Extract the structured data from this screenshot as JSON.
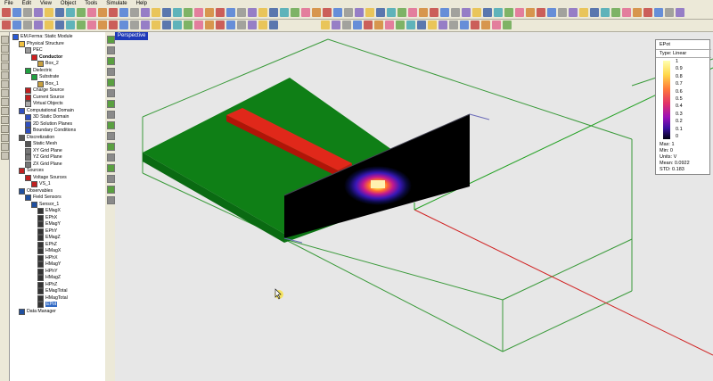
{
  "menu": [
    "File",
    "Edit",
    "View",
    "Object",
    "Tools",
    "Simulate",
    "Help"
  ],
  "viewport": {
    "tab_label": "Perspective"
  },
  "tree": [
    {
      "label": "EM.Ferma: Static Module",
      "depth": 0,
      "icon": "app-icon"
    },
    {
      "label": "Physical Structure",
      "depth": 1,
      "icon": "folder-icon"
    },
    {
      "label": "PEC",
      "depth": 2,
      "icon": "pec-icon"
    },
    {
      "label": "Conductor",
      "depth": 3,
      "icon": "conductor-icon",
      "bold": true
    },
    {
      "label": "Box_2",
      "depth": 4,
      "icon": "box-icon"
    },
    {
      "label": "Dielectric",
      "depth": 2,
      "icon": "dielectric-icon"
    },
    {
      "label": "Substrate",
      "depth": 3,
      "icon": "substrate-icon"
    },
    {
      "label": "Box_1",
      "depth": 4,
      "icon": "box-icon"
    },
    {
      "label": "Charge Source",
      "depth": 2,
      "icon": "charge-icon"
    },
    {
      "label": "Current Source",
      "depth": 2,
      "icon": "current-icon"
    },
    {
      "label": "Virtual Objects",
      "depth": 2,
      "icon": "virtual-icon"
    },
    {
      "label": "Computational Domain",
      "depth": 1,
      "icon": "domain-icon"
    },
    {
      "label": "3D Static Domain",
      "depth": 2,
      "icon": "domain3d-icon"
    },
    {
      "label": "2D Solution Planes",
      "depth": 2,
      "icon": "plane-icon"
    },
    {
      "label": "Boundary Conditions",
      "depth": 2,
      "icon": "boundary-icon"
    },
    {
      "label": "Discretization",
      "depth": 1,
      "icon": "mesh-folder-icon"
    },
    {
      "label": "Static Mesh",
      "depth": 2,
      "icon": "mesh-icon"
    },
    {
      "label": "XY Grid Plane",
      "depth": 2,
      "icon": "grid-icon"
    },
    {
      "label": "YZ Grid Plane",
      "depth": 2,
      "icon": "grid-icon"
    },
    {
      "label": "ZX Grid Plane",
      "depth": 2,
      "icon": "grid-icon"
    },
    {
      "label": "Sources",
      "depth": 1,
      "icon": "sources-icon"
    },
    {
      "label": "Voltage Sources",
      "depth": 2,
      "icon": "voltage-icon"
    },
    {
      "label": "VS_1",
      "depth": 3,
      "icon": "vs-icon"
    },
    {
      "label": "Observables",
      "depth": 1,
      "icon": "observables-icon"
    },
    {
      "label": "Field Sensors",
      "depth": 2,
      "icon": "sensor-folder-icon"
    },
    {
      "label": "Sensor_1",
      "depth": 3,
      "icon": "sensor-icon"
    },
    {
      "label": "EMagX",
      "depth": 4,
      "icon": "field-icon"
    },
    {
      "label": "EPhX",
      "depth": 4,
      "icon": "field-icon"
    },
    {
      "label": "EMagY",
      "depth": 4,
      "icon": "field-icon"
    },
    {
      "label": "EPhY",
      "depth": 4,
      "icon": "field-icon"
    },
    {
      "label": "EMagZ",
      "depth": 4,
      "icon": "field-icon"
    },
    {
      "label": "EPhZ",
      "depth": 4,
      "icon": "field-icon"
    },
    {
      "label": "HMagX",
      "depth": 4,
      "icon": "field-icon"
    },
    {
      "label": "HPhX",
      "depth": 4,
      "icon": "field-icon"
    },
    {
      "label": "HMagY",
      "depth": 4,
      "icon": "field-icon"
    },
    {
      "label": "HPhY",
      "depth": 4,
      "icon": "field-icon"
    },
    {
      "label": "HMagZ",
      "depth": 4,
      "icon": "field-icon"
    },
    {
      "label": "HPhZ",
      "depth": 4,
      "icon": "field-icon"
    },
    {
      "label": "EMagTotal",
      "depth": 4,
      "icon": "field-icon"
    },
    {
      "label": "HMagTotal",
      "depth": 4,
      "icon": "field-icon"
    },
    {
      "label": "EPot",
      "depth": 4,
      "icon": "field-icon",
      "selected": true
    },
    {
      "label": "Data Manager",
      "depth": 1,
      "icon": "data-manager-icon"
    }
  ],
  "legend": {
    "title": "EPot",
    "type": "Type: Linear",
    "ticks": [
      "1",
      "0.9",
      "0.8",
      "0.7",
      "0.6",
      "0.5",
      "0.4",
      "0.3",
      "0.2",
      "0.1",
      "0"
    ],
    "stats": [
      "Max: 1",
      "Min: 0",
      "Units: V",
      "Mean: 0.0922",
      "STD: 0.183"
    ]
  },
  "colors": {
    "substrate": "#0f7f16",
    "conductor": "#d4180e",
    "domain_line": "#3a9a3a",
    "axis_red": "#d02020",
    "axis_green": "#20a020",
    "accent": "#1f3ab8"
  }
}
